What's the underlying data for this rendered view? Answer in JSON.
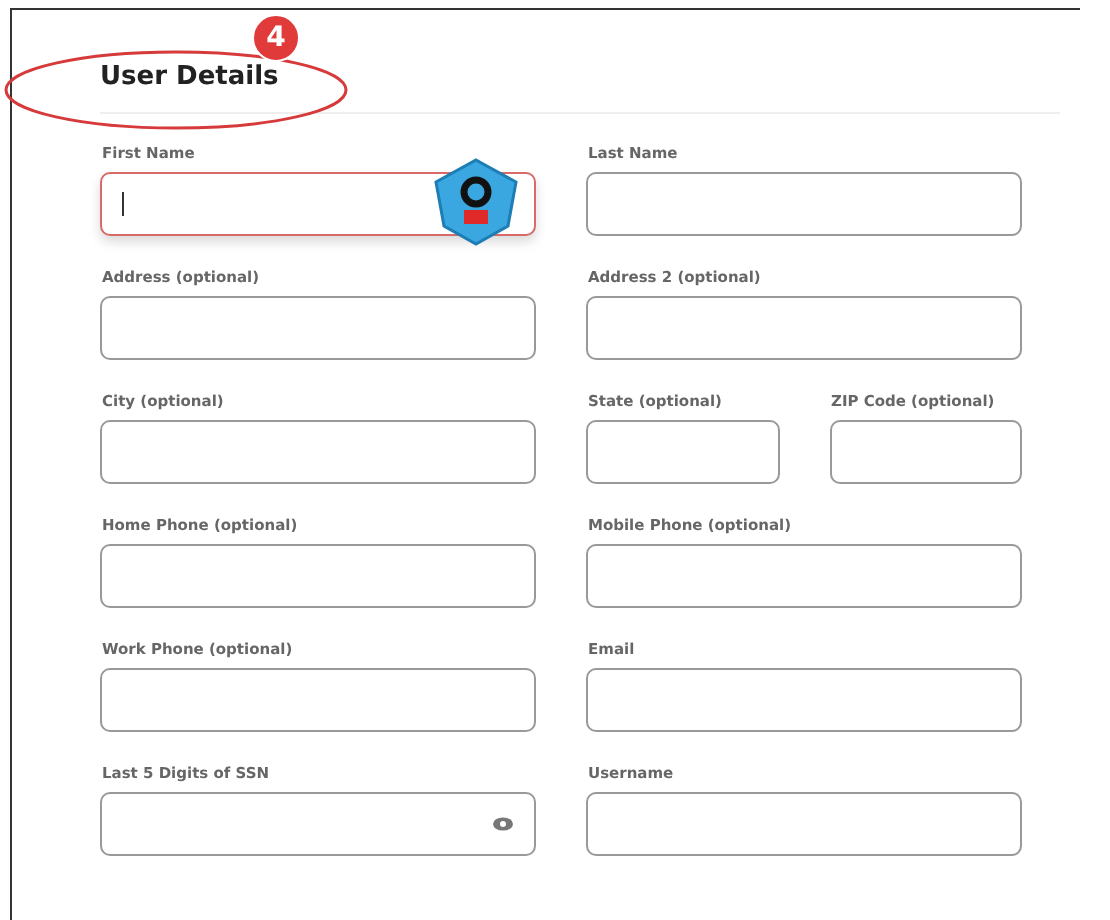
{
  "heading": "User Details",
  "step_badge": "4",
  "rows": [
    {
      "left": {
        "label": "First Name",
        "kind": "text",
        "focused": true
      },
      "right": [
        {
          "label": "Last Name",
          "kind": "text",
          "focused": false
        }
      ]
    },
    {
      "left": {
        "label": "Address (optional)",
        "kind": "text",
        "focused": false
      },
      "right": [
        {
          "label": "Address 2 (optional)",
          "kind": "text",
          "focused": false
        }
      ]
    },
    {
      "left": {
        "label": "City (optional)",
        "kind": "text",
        "focused": false
      },
      "right": [
        {
          "label": "State (optional)",
          "kind": "text",
          "focused": false
        },
        {
          "label": "ZIP Code (optional)",
          "kind": "text",
          "focused": false
        }
      ]
    },
    {
      "left": {
        "label": "Home Phone (optional)",
        "kind": "text",
        "focused": false
      },
      "right": [
        {
          "label": "Mobile Phone (optional)",
          "kind": "text",
          "focused": false
        }
      ]
    },
    {
      "left": {
        "label": "Work Phone (optional)",
        "kind": "text",
        "focused": false
      },
      "right": [
        {
          "label": "Email",
          "kind": "text",
          "focused": false
        }
      ]
    },
    {
      "left": {
        "label": "Last 5 Digits of SSN",
        "kind": "secret",
        "focused": false
      },
      "right": [
        {
          "label": "Username",
          "kind": "text",
          "focused": false
        }
      ]
    }
  ]
}
